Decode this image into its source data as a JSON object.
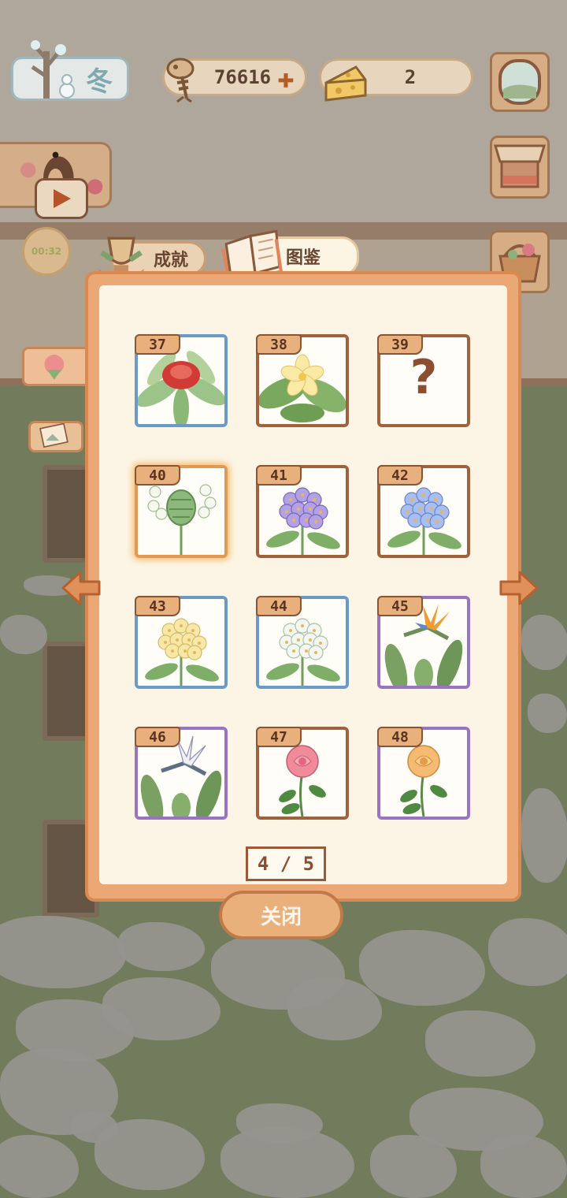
{
  "hud": {
    "season": "冬",
    "fish_bones": "76616",
    "cheese": "2",
    "timer": "00:32"
  },
  "tabs": [
    {
      "label": "成就"
    },
    {
      "label": "图鉴"
    }
  ],
  "codex": {
    "cards": [
      {
        "number": "37",
        "frame": "blue",
        "flower": "red-bulb"
      },
      {
        "number": "38",
        "frame": "brown",
        "flower": "plumeria"
      },
      {
        "number": "39",
        "frame": "brown",
        "flower": "unknown",
        "mark": "?"
      },
      {
        "number": "40",
        "frame": "selected",
        "flower": "white-bud"
      },
      {
        "number": "41",
        "frame": "brown",
        "flower": "purple-hydrangea"
      },
      {
        "number": "42",
        "frame": "brown",
        "flower": "blue-hydrangea"
      },
      {
        "number": "43",
        "frame": "blue",
        "flower": "yellow-cluster"
      },
      {
        "number": "44",
        "frame": "blue",
        "flower": "white-cluster"
      },
      {
        "number": "45",
        "frame": "purple",
        "flower": "orange-bird-of-paradise"
      },
      {
        "number": "46",
        "frame": "purple",
        "flower": "white-bird-of-paradise"
      },
      {
        "number": "47",
        "frame": "brown",
        "flower": "pink-rose"
      },
      {
        "number": "48",
        "frame": "purple",
        "flower": "orange-rose"
      }
    ],
    "page": "4 / 5",
    "close_label": "关闭"
  },
  "colors": {
    "dialog_frame": "#eba874",
    "dialog_paper": "#fcf5e5",
    "frame_blue": "#6a9bc8",
    "frame_purple": "#9a73c2",
    "frame_brown": "#a0613d"
  }
}
